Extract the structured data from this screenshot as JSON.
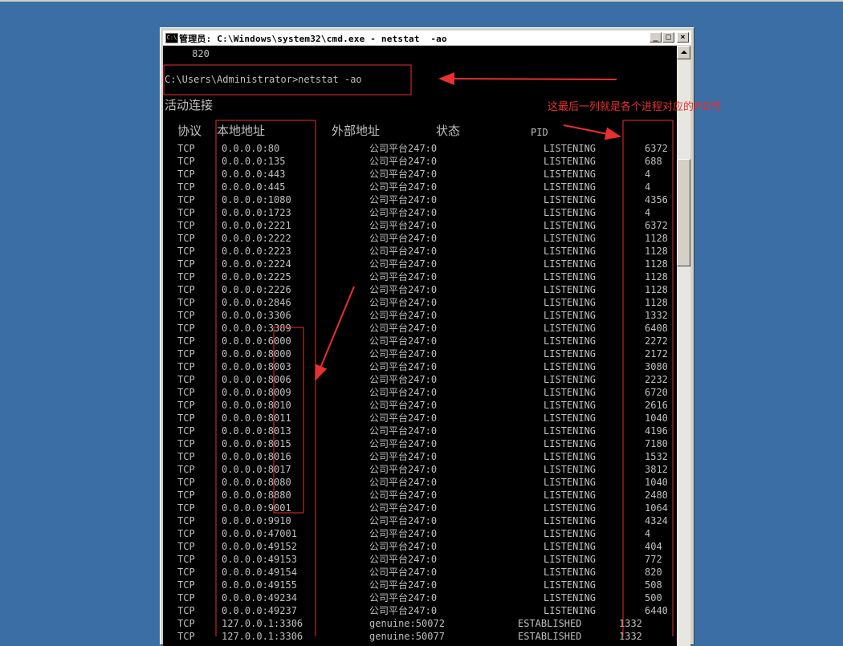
{
  "window": {
    "title": "管理员: C:\\Windows\\system32\\cmd.exe - netstat  -ao",
    "icon": "cmd-icon",
    "buttons": [
      "minimize",
      "maximize",
      "close"
    ]
  },
  "console": {
    "prev_line": "     820",
    "prompt": "C:\\Users\\Administrator>netstat -ao",
    "section_title": "活动连接",
    "headers": {
      "proto": "协议",
      "local": "本地地址",
      "foreign": "外部地址",
      "state": "状态",
      "pid": "PID"
    },
    "rows": [
      {
        "proto": "TCP",
        "local": "0.0.0.0:80",
        "foreign": "公司平台247:0",
        "state": "LISTENING",
        "pid": "6372"
      },
      {
        "proto": "TCP",
        "local": "0.0.0.0:135",
        "foreign": "公司平台247:0",
        "state": "LISTENING",
        "pid": "688"
      },
      {
        "proto": "TCP",
        "local": "0.0.0.0:443",
        "foreign": "公司平台247:0",
        "state": "LISTENING",
        "pid": "4"
      },
      {
        "proto": "TCP",
        "local": "0.0.0.0:445",
        "foreign": "公司平台247:0",
        "state": "LISTENING",
        "pid": "4"
      },
      {
        "proto": "TCP",
        "local": "0.0.0.0:1080",
        "foreign": "公司平台247:0",
        "state": "LISTENING",
        "pid": "4356"
      },
      {
        "proto": "TCP",
        "local": "0.0.0.0:1723",
        "foreign": "公司平台247:0",
        "state": "LISTENING",
        "pid": "4"
      },
      {
        "proto": "TCP",
        "local": "0.0.0.0:2221",
        "foreign": "公司平台247:0",
        "state": "LISTENING",
        "pid": "6372"
      },
      {
        "proto": "TCP",
        "local": "0.0.0.0:2222",
        "foreign": "公司平台247:0",
        "state": "LISTENING",
        "pid": "1128"
      },
      {
        "proto": "TCP",
        "local": "0.0.0.0:2223",
        "foreign": "公司平台247:0",
        "state": "LISTENING",
        "pid": "1128"
      },
      {
        "proto": "TCP",
        "local": "0.0.0.0:2224",
        "foreign": "公司平台247:0",
        "state": "LISTENING",
        "pid": "1128"
      },
      {
        "proto": "TCP",
        "local": "0.0.0.0:2225",
        "foreign": "公司平台247:0",
        "state": "LISTENING",
        "pid": "1128"
      },
      {
        "proto": "TCP",
        "local": "0.0.0.0:2226",
        "foreign": "公司平台247:0",
        "state": "LISTENING",
        "pid": "1128"
      },
      {
        "proto": "TCP",
        "local": "0.0.0.0:2846",
        "foreign": "公司平台247:0",
        "state": "LISTENING",
        "pid": "1128"
      },
      {
        "proto": "TCP",
        "local": "0.0.0.0:3306",
        "foreign": "公司平台247:0",
        "state": "LISTENING",
        "pid": "1332"
      },
      {
        "proto": "TCP",
        "local": "0.0.0.0:3389",
        "foreign": "公司平台247:0",
        "state": "LISTENING",
        "pid": "6408"
      },
      {
        "proto": "TCP",
        "local": "0.0.0.0:6000",
        "foreign": "公司平台247:0",
        "state": "LISTENING",
        "pid": "2272"
      },
      {
        "proto": "TCP",
        "local": "0.0.0.0:8000",
        "foreign": "公司平台247:0",
        "state": "LISTENING",
        "pid": "2172"
      },
      {
        "proto": "TCP",
        "local": "0.0.0.0:8003",
        "foreign": "公司平台247:0",
        "state": "LISTENING",
        "pid": "3080"
      },
      {
        "proto": "TCP",
        "local": "0.0.0.0:8006",
        "foreign": "公司平台247:0",
        "state": "LISTENING",
        "pid": "2232"
      },
      {
        "proto": "TCP",
        "local": "0.0.0.0:8009",
        "foreign": "公司平台247:0",
        "state": "LISTENING",
        "pid": "6720"
      },
      {
        "proto": "TCP",
        "local": "0.0.0.0:8010",
        "foreign": "公司平台247:0",
        "state": "LISTENING",
        "pid": "2616"
      },
      {
        "proto": "TCP",
        "local": "0.0.0.0:8011",
        "foreign": "公司平台247:0",
        "state": "LISTENING",
        "pid": "1040"
      },
      {
        "proto": "TCP",
        "local": "0.0.0.0:8013",
        "foreign": "公司平台247:0",
        "state": "LISTENING",
        "pid": "4196"
      },
      {
        "proto": "TCP",
        "local": "0.0.0.0:8015",
        "foreign": "公司平台247:0",
        "state": "LISTENING",
        "pid": "7180"
      },
      {
        "proto": "TCP",
        "local": "0.0.0.0:8016",
        "foreign": "公司平台247:0",
        "state": "LISTENING",
        "pid": "1532"
      },
      {
        "proto": "TCP",
        "local": "0.0.0.0:8017",
        "foreign": "公司平台247:0",
        "state": "LISTENING",
        "pid": "3812"
      },
      {
        "proto": "TCP",
        "local": "0.0.0.0:8080",
        "foreign": "公司平台247:0",
        "state": "LISTENING",
        "pid": "1040"
      },
      {
        "proto": "TCP",
        "local": "0.0.0.0:8880",
        "foreign": "公司平台247:0",
        "state": "LISTENING",
        "pid": "2480"
      },
      {
        "proto": "TCP",
        "local": "0.0.0.0:9001",
        "foreign": "公司平台247:0",
        "state": "LISTENING",
        "pid": "1064"
      },
      {
        "proto": "TCP",
        "local": "0.0.0.0:9910",
        "foreign": "公司平台247:0",
        "state": "LISTENING",
        "pid": "4324"
      },
      {
        "proto": "TCP",
        "local": "0.0.0.0:47001",
        "foreign": "公司平台247:0",
        "state": "LISTENING",
        "pid": "4"
      },
      {
        "proto": "TCP",
        "local": "0.0.0.0:49152",
        "foreign": "公司平台247:0",
        "state": "LISTENING",
        "pid": "404"
      },
      {
        "proto": "TCP",
        "local": "0.0.0.0:49153",
        "foreign": "公司平台247:0",
        "state": "LISTENING",
        "pid": "772"
      },
      {
        "proto": "TCP",
        "local": "0.0.0.0:49154",
        "foreign": "公司平台247:0",
        "state": "LISTENING",
        "pid": "820"
      },
      {
        "proto": "TCP",
        "local": "0.0.0.0:49155",
        "foreign": "公司平台247:0",
        "state": "LISTENING",
        "pid": "508"
      },
      {
        "proto": "TCP",
        "local": "0.0.0.0:49234",
        "foreign": "公司平台247:0",
        "state": "LISTENING",
        "pid": "500"
      },
      {
        "proto": "TCP",
        "local": "0.0.0.0:49237",
        "foreign": "公司平台247:0",
        "state": "LISTENING",
        "pid": "6440"
      },
      {
        "proto": "TCP",
        "local": "127.0.0.1:3306",
        "foreign": "genuine:50072",
        "state": "ESTABLISHED",
        "pid": "1332"
      },
      {
        "proto": "TCP",
        "local": "127.0.0.1:3306",
        "foreign": "genuine:50077",
        "state": "ESTABLISHED",
        "pid": "1332"
      }
    ]
  },
  "annotation": {
    "note": "这最后一列就是各个进程对应的PID号",
    "color": "#e83030"
  },
  "colors": {
    "desktop": "#3a6ea5",
    "console_bg": "#000000",
    "console_text": "#c0c0c0"
  }
}
